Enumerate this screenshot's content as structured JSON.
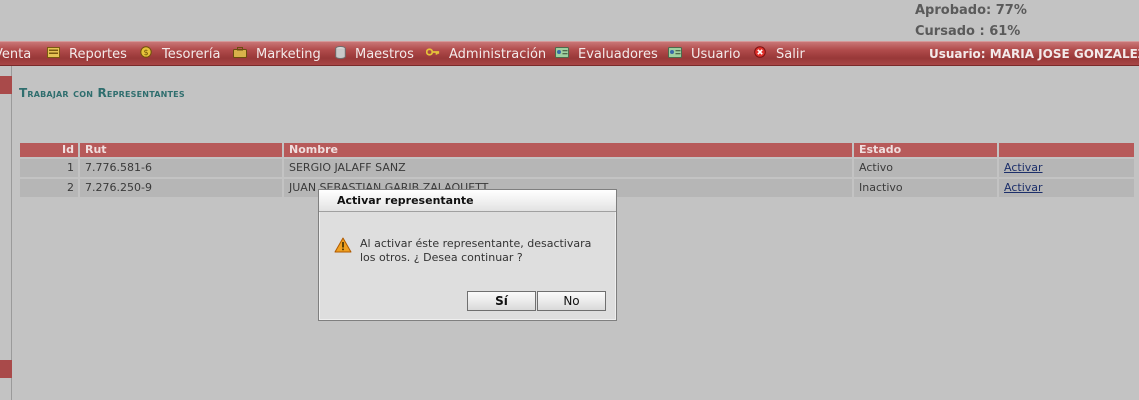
{
  "stats": {
    "aprobado": "Aprobado: 77%",
    "cursado": "Cursado : 61%"
  },
  "menu": {
    "items": [
      {
        "label": "Venta",
        "icon": "none"
      },
      {
        "label": "Reportes",
        "icon": "folder-icon"
      },
      {
        "label": "Tesorería",
        "icon": "coin-icon"
      },
      {
        "label": "Marketing",
        "icon": "briefcase-icon"
      },
      {
        "label": "Maestros",
        "icon": "database-icon"
      },
      {
        "label": "Administración",
        "icon": "key-icon"
      },
      {
        "label": "Evaluadores",
        "icon": "id-card-icon"
      },
      {
        "label": "Usuario",
        "icon": "id-card-icon"
      },
      {
        "label": "Salir",
        "icon": "exit-icon"
      }
    ],
    "user": "Usuario:  MARIA JOSE GONZALEZ"
  },
  "page": {
    "title": "Trabajar con Representantes"
  },
  "table": {
    "columns": [
      "Id",
      "Rut",
      "Nombre",
      "Estado",
      ""
    ],
    "rows": [
      {
        "id": "1",
        "rut": "7.776.581-6",
        "nombre": "SERGIO JALAFF SANZ",
        "estado": "Activo",
        "accion": "Activar"
      },
      {
        "id": "2",
        "rut": "7.276.250-9",
        "nombre": "JUAN SEBASTIAN GARIB ZALAQUETT",
        "estado": "Inactivo",
        "accion": "Activar"
      }
    ]
  },
  "dialog": {
    "title": "Activar representante",
    "message": "Al activar éste representante, desactivara los otros. ¿ Desea continuar ?",
    "yes_label": "Sí",
    "no_label": "No"
  },
  "colors": {
    "menubar": "#a84646",
    "header": "#b75a5a",
    "background": "#c3c3c3",
    "title": "#2f6e6e"
  }
}
